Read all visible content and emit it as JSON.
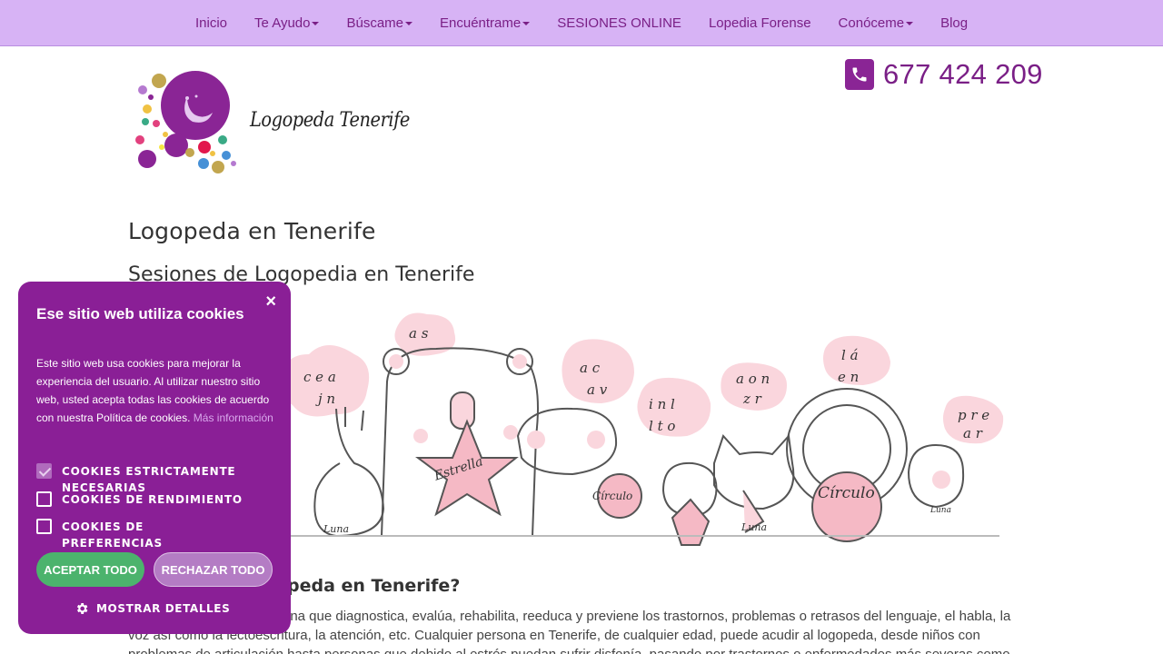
{
  "nav": {
    "items": [
      {
        "label": "Inicio",
        "dropdown": false
      },
      {
        "label": "Te Ayudo",
        "dropdown": true
      },
      {
        "label": "Búscame",
        "dropdown": true
      },
      {
        "label": "Encuéntrame",
        "dropdown": true
      },
      {
        "label": "SESIONES ONLINE",
        "dropdown": false
      },
      {
        "label": "Lopedia Forense",
        "dropdown": false
      },
      {
        "label": "Conóceme",
        "dropdown": true
      },
      {
        "label": "Blog",
        "dropdown": false
      }
    ]
  },
  "header": {
    "brand": "Logopeda Tenerife",
    "phone": "677 424 209",
    "phone_icon": "phone-icon",
    "accent_color": "#7a1f86"
  },
  "content": {
    "title": "Logopeda en Tenerife",
    "subtitle": "Sesiones de Logopedia en Tenerife",
    "section_heading": "peda en Tenerife?",
    "paragraph_lines": [
      "ina que diagnostica, evalúa, rehabilita, reeduca y previene los trastornos, problemas o retrasos del lenguaje, el habla, la",
      "voz así como la lectoescritura, la atención, etc. Cualquier persona en Tenerife, de cualquier edad, puede acudir al logopeda, desde niños con",
      "problemas de articulación hasta personas que debido al estrés puedan sufrir disfonía, pasando por trastornos o enfermedades más severas como"
    ],
    "illustration_words": [
      "Estrella",
      "Círculo",
      "Círculo",
      "Luna",
      "Luna",
      "Luna"
    ]
  },
  "cookie": {
    "title": "Ese sitio web utiliza cookies",
    "text": "Este sitio web usa cookies para mejorar la experiencia del usuario. Al utilizar nuestro sitio web, usted acepta todas las cookies de acuerdo con nuestra Política de cookies.",
    "more": "Más información",
    "options": [
      {
        "label": "COOKIES ESTRICTAMENTE NECESARIAS",
        "checked": true
      },
      {
        "label": "COOKIES DE RENDIMIENTO",
        "checked": false
      },
      {
        "label": "COOKIES DE PREFERENCIAS",
        "checked": false
      }
    ],
    "accept_label": "ACEPTAR TODO",
    "reject_label": "RECHAZAR TODO",
    "details_label": "MOSTRAR DETALLES",
    "close_label": "×",
    "bg_color": "#8a1f96",
    "accept_color": "#4cb36d"
  }
}
